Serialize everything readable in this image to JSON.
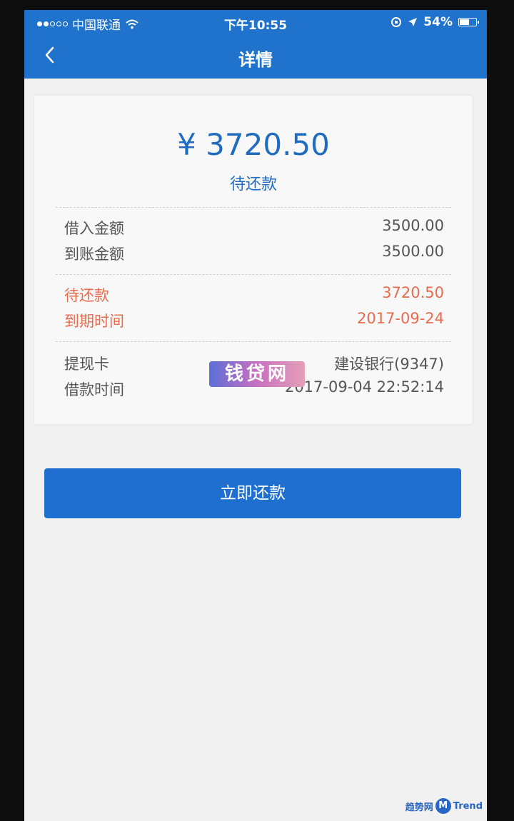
{
  "status_bar": {
    "carrier": "中国联通",
    "time": "下午10:55",
    "battery": "54%",
    "battery_level": 0.54
  },
  "nav": {
    "title": "详情"
  },
  "summary": {
    "amount": "¥ 3720.50",
    "label": "待还款"
  },
  "loan": {
    "rows": [
      {
        "label": "借入金额",
        "value": "3500.00"
      },
      {
        "label": "到账金额",
        "value": "3500.00"
      }
    ]
  },
  "due": {
    "rows": [
      {
        "label": "待还款",
        "value": "3720.50"
      },
      {
        "label": "到期时间",
        "value": "2017-09-24"
      }
    ],
    "color": "#e86b4e"
  },
  "card_info": {
    "rows": [
      {
        "label": "提现卡",
        "value": "建设银行(9347)"
      },
      {
        "label": "借款时间",
        "value": "2017-09-04 22:52:14"
      }
    ]
  },
  "watermark": {
    "text": "钱贷网"
  },
  "actions": {
    "repay_label": "立即还款"
  },
  "footer": {
    "brand": "趋势网",
    "logo_letter": "M",
    "trend": "Trend"
  },
  "colors": {
    "primary": "#1f73cc",
    "accent_text": "#1f6cc0"
  }
}
